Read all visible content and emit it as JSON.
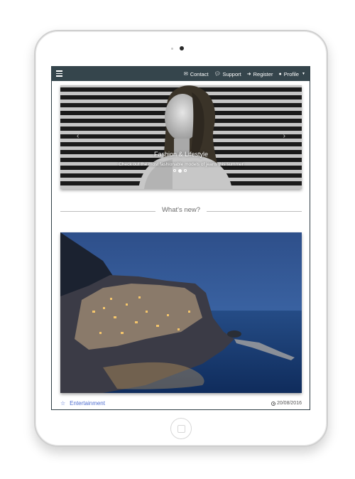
{
  "navbar": {
    "menu_icon": "hamburger-icon",
    "items": [
      {
        "label": "Contact",
        "icon": "envelope-icon"
      },
      {
        "label": "Support",
        "icon": "chat-icon"
      },
      {
        "label": "Register",
        "icon": "sign-in-icon"
      },
      {
        "label": "Profile",
        "icon": "user-icon"
      }
    ]
  },
  "carousel": {
    "title": "Fashion & Lifestyle",
    "subtitle": "Check out the most fashionable models of jeans this summer",
    "slide_count": 3,
    "active_slide": 2
  },
  "section": {
    "heading": "What's new?"
  },
  "article": {
    "category": "Entertainment",
    "category_icon": "star-icon",
    "date": "20/08/2016",
    "date_icon": "clock-icon"
  },
  "colors": {
    "navbar_bg": "#35454c",
    "link_blue": "#4f6ed0",
    "divider": "#bdbdbd"
  }
}
